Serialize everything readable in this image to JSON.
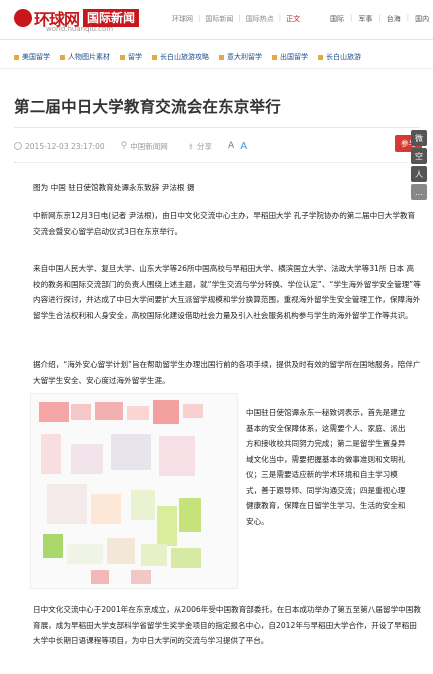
{
  "header": {
    "logo_text": "环球网",
    "logo_badge": "国际新闻",
    "logo_url": "world.huanqiu.com",
    "breadcrumb": [
      "环球网",
      "国际新闻",
      "国际热点",
      "正文"
    ],
    "right_nav": [
      "国际",
      "军事",
      "台海",
      "国内"
    ]
  },
  "channels": [
    "美国留学",
    "人物图片素材",
    "留学",
    "长白山旅游攻略",
    "意大利留学",
    "出国留学",
    "长白山旅游"
  ],
  "article": {
    "title": "第二届中日大学教育交流会在东京举行",
    "timestamp": "2015-12-03 23:17:00",
    "source": "中国新闻网",
    "share_label": "分享",
    "font_small": "A",
    "font_large": "A",
    "comment_label": "参与",
    "caption": "图为 中国 驻日使馆教育处谭永东致辞 尹法根 摄",
    "para1": "中新网东京12月3日电(记者 尹法根)，由日中文化交流中心主办，早稻田大学 孔子学院协办的第二届中日大学教育交流会暨安心留学启动仪式3日在东京举行。",
    "para2": "来自中国人民大学、复旦大学、山东大学等26所中国高校与早稻田大学、横滨国立大学、法政大学等31所 日本 高校的教务和国际交流部门的负责人围绕上述主题，就“学生交流与学分转换、学位认定”、“学生海外留学安全管理”等内容进行探讨，并达成了中日大学间要扩大互派留学规模和学分换算范围，重视海外留学生安全管理工作，保障海外留学生合法权利和人身安全，高校国际化建设借助社会力量及引入社会服务机构参与学生的海外留学工作等共识。",
    "para3": "据介绍，“海外安心留学计划”旨在帮助留学生办理出国行前的各项手续，提供及时有效的留学所在国地服务，陪伴广大留学生安全、安心度过海外留学生涯。",
    "para4": "中国驻日使馆谭永东一秘致词表示，首先是建立基本的安全保障体系，这需要个人、家庭、派出方和接收校共同努力完成；第二是留学生置身异域文化当中，需要把握基本的做事准则和文明礼仪；三是需要适应新的学术环境和自主学习模式，善于跟导师、同学沟通交流；四是重视心理健康教育，保障在日留学生学习、生活的安全和安心。",
    "para5": "日中文化交流中心于2001年在东京成立，从2006年受中国教育部委托，在日本成功举办了第五至第八届留学中国教育展，成为早稻田大学支部科学省留学生奖学金项目的指定报名中心，自2012年与早稻田大学合作，开设了早稻田大学中长期日语课程等项目，为中日大学间的交流与学习提供了平台。"
  },
  "side_share": [
    "微",
    "空",
    "人",
    "…"
  ],
  "colors": {
    "brand_red": "#c8161d",
    "link_blue": "#1a4e8c"
  }
}
